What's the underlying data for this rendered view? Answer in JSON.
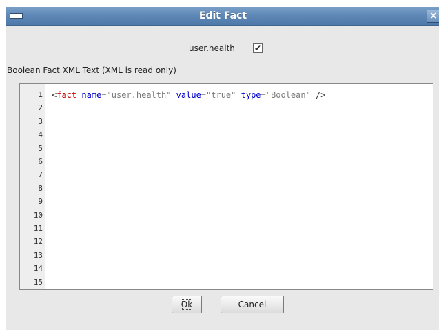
{
  "window": {
    "title": "Edit Fact",
    "close_glyph": "×",
    "icons": {
      "menu": "window-menu-icon",
      "close": "close-icon"
    }
  },
  "fact": {
    "name": "user.health",
    "checked": true,
    "check_glyph": "✔"
  },
  "section_label": "Boolean Fact XML Text (XML is read only)",
  "editor": {
    "line_numbers": [
      "1",
      "2",
      "3",
      "4",
      "5",
      "6",
      "7",
      "8",
      "9",
      "10",
      "11",
      "12",
      "13",
      "14",
      "15"
    ],
    "tokens": {
      "open": "<",
      "tag": "fact",
      "attr_name": "name",
      "eq1": "=",
      "val_name": "\"user.health\"",
      "attr_value": "value",
      "eq2": "=",
      "val_value": "\"true\"",
      "attr_type": "type",
      "eq3": "=",
      "val_type": "\"Boolean\"",
      "close": "/>"
    },
    "colors": {
      "tag": "#cc0000",
      "attr": "#0000cc",
      "value": "#7a7a7a"
    }
  },
  "buttons": {
    "ok_label": "Ok",
    "cancel_label": "Cancel"
  }
}
